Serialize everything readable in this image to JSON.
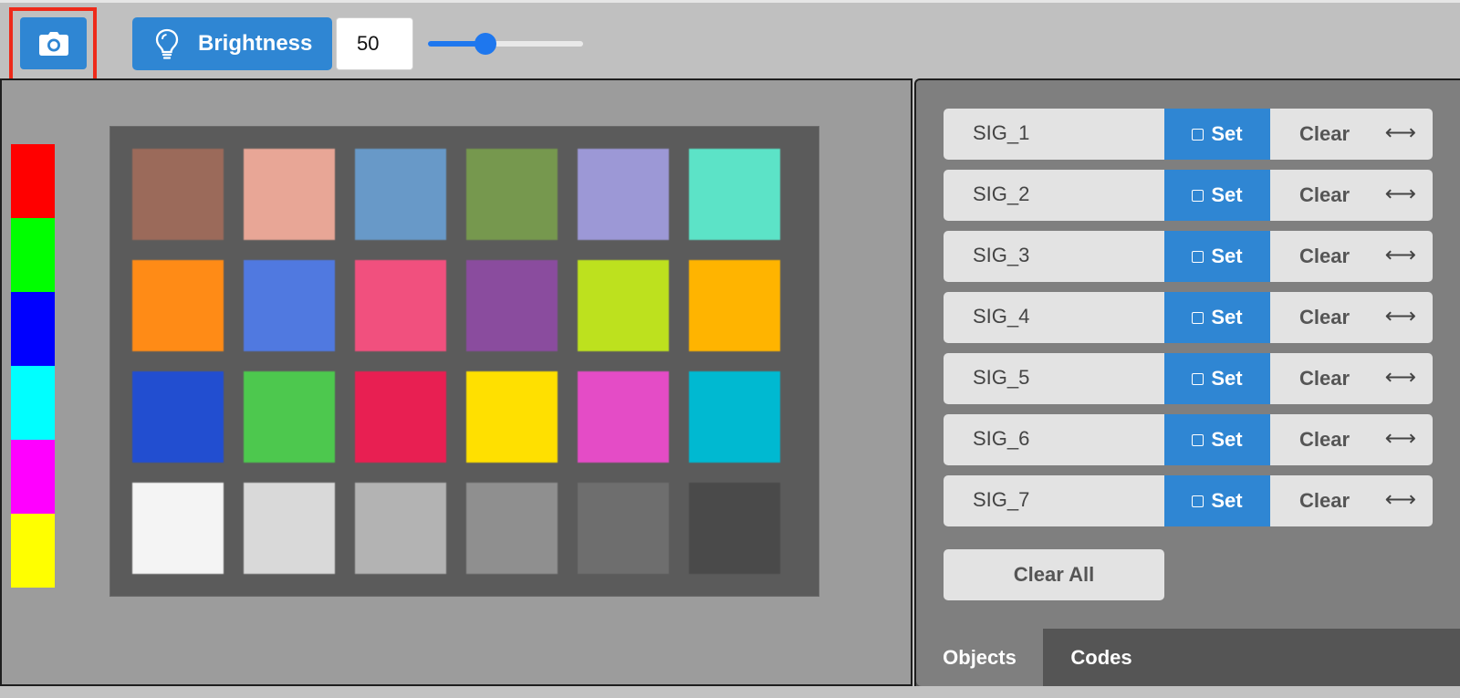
{
  "toolbar": {
    "camera_icon": "camera-icon",
    "brightness_icon": "lightbulb-icon",
    "brightness_label": "Brightness",
    "brightness_value": "50",
    "slider_fraction": 0.37,
    "accent": "#2f86d3"
  },
  "color_strip": [
    "#ff0000",
    "#00ff00",
    "#0000ff",
    "#00ffff",
    "#ff00ff",
    "#ffff00"
  ],
  "color_chart": {
    "rows": [
      [
        "#9b6a5a",
        "#e8a696",
        "#6899c8",
        "#76984e",
        "#9c98d6",
        "#5ce3c7"
      ],
      [
        "#ff8b16",
        "#5079e0",
        "#f1507e",
        "#8a4c9e",
        "#bde11e",
        "#ffb400"
      ],
      [
        "#224ed0",
        "#4dc84e",
        "#e81f52",
        "#ffe000",
        "#e44cc6",
        "#00b9d1"
      ],
      [
        "#f4f4f4",
        "#d9d9d9",
        "#b3b3b3",
        "#8f8f8f",
        "#6e6e6e",
        "#4a4a4a"
      ]
    ]
  },
  "signatures": [
    {
      "name": "SIG_1",
      "set": "Set",
      "clear": "Clear",
      "swap": "⟷"
    },
    {
      "name": "SIG_2",
      "set": "Set",
      "clear": "Clear",
      "swap": "⟷"
    },
    {
      "name": "SIG_3",
      "set": "Set",
      "clear": "Clear",
      "swap": "⟷"
    },
    {
      "name": "SIG_4",
      "set": "Set",
      "clear": "Clear",
      "swap": "⟷"
    },
    {
      "name": "SIG_5",
      "set": "Set",
      "clear": "Clear",
      "swap": "⟷"
    },
    {
      "name": "SIG_6",
      "set": "Set",
      "clear": "Clear",
      "swap": "⟷"
    },
    {
      "name": "SIG_7",
      "set": "Set",
      "clear": "Clear",
      "swap": "⟷"
    }
  ],
  "clear_all_label": "Clear All",
  "tabs": [
    {
      "label": "Objects",
      "active": true
    },
    {
      "label": "Codes",
      "active": false
    }
  ]
}
